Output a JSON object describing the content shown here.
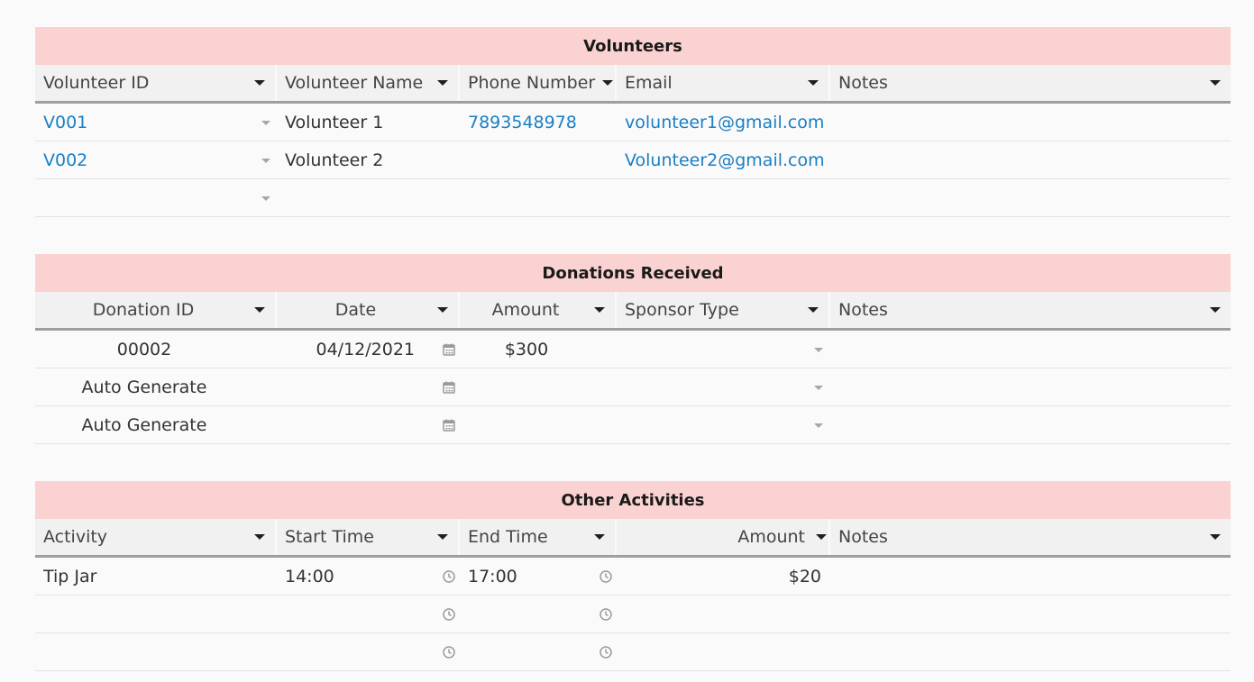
{
  "volunteers": {
    "title": "Volunteers",
    "headers": [
      "Volunteer ID",
      "Volunteer Name",
      "Phone Number",
      "Email",
      "Notes"
    ],
    "rows": [
      {
        "id": "V001",
        "name": "Volunteer 1",
        "phone": "7893548978",
        "email": "volunteer1@gmail.com",
        "notes": ""
      },
      {
        "id": "V002",
        "name": "Volunteer 2",
        "phone": "",
        "email": "Volunteer2@gmail.com",
        "notes": ""
      },
      {
        "id": "",
        "name": "",
        "phone": "",
        "email": "",
        "notes": ""
      }
    ]
  },
  "donations": {
    "title": "Donations Received",
    "headers": [
      "Donation ID",
      "Date",
      "Amount",
      "Sponsor Type",
      "Notes"
    ],
    "rows": [
      {
        "id": "00002",
        "date": "04/12/2021",
        "amount": "$300",
        "sponsor": "",
        "notes": ""
      },
      {
        "id": "Auto Generate",
        "date": "",
        "amount": "",
        "sponsor": "",
        "notes": ""
      },
      {
        "id": "Auto Generate",
        "date": "",
        "amount": "",
        "sponsor": "",
        "notes": ""
      }
    ]
  },
  "activities": {
    "title": "Other Activities",
    "headers": [
      "Activity",
      "Start Time",
      "End Time",
      "Amount",
      "Notes"
    ],
    "rows": [
      {
        "activity": "Tip Jar",
        "start": "14:00",
        "end": "17:00",
        "amount": "$20",
        "notes": ""
      },
      {
        "activity": "",
        "start": "",
        "end": "",
        "amount": "",
        "notes": ""
      },
      {
        "activity": "",
        "start": "",
        "end": "",
        "amount": "",
        "notes": ""
      }
    ]
  },
  "icons": {
    "column_menu": "caret-down-icon",
    "dropdown": "small-caret-icon",
    "date_picker": "calendar-icon",
    "time_picker": "clock-icon"
  },
  "colors": {
    "title_bar": "#f9d2d1",
    "header_row": "#f1f1f1",
    "link": "#1a7fc4"
  }
}
